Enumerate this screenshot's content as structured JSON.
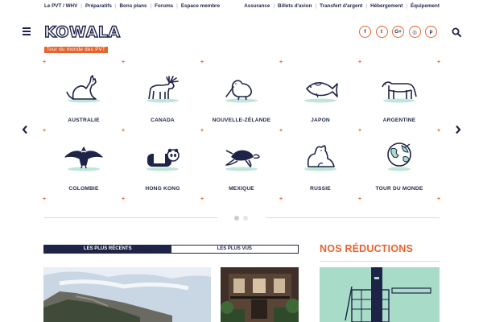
{
  "topbar": {
    "left": [
      "Le PVT / WHV",
      "Préparatifs",
      "Bons plans",
      "Forums",
      "Espace membre"
    ],
    "right": [
      "Assurance",
      "Billets d'avion",
      "Transfert d'argent",
      "Hébergement",
      "Équipement"
    ]
  },
  "header": {
    "logo_word": "KOWALA",
    "logo_tagline": "Tour du monde des PVT",
    "socials": [
      {
        "icon": "facebook-icon",
        "glyph": "f"
      },
      {
        "icon": "twitter-icon",
        "glyph": "t"
      },
      {
        "icon": "google-plus-icon",
        "glyph": "G+"
      },
      {
        "icon": "instagram-icon",
        "glyph": "◎"
      },
      {
        "icon": "pinterest-icon",
        "glyph": "p"
      }
    ],
    "search_icon": "search-icon",
    "menu_icon": "hamburger-menu-icon"
  },
  "destinations": [
    {
      "label": "AUSTRALIE",
      "icon": "kangaroo-icon"
    },
    {
      "label": "CANADA",
      "icon": "moose-icon"
    },
    {
      "label": "NOUVELLE-ZÉLANDE",
      "icon": "kiwi-bird-icon"
    },
    {
      "label": "JAPON",
      "icon": "koi-fish-icon"
    },
    {
      "label": "ARGENTINE",
      "icon": "puma-icon"
    },
    {
      "label": "COLOMBIE",
      "icon": "condor-icon"
    },
    {
      "label": "HONG KONG",
      "icon": "panda-icon"
    },
    {
      "label": "MEXIQUE",
      "icon": "sea-turtle-icon"
    },
    {
      "label": "RUSSIE",
      "icon": "bear-icon"
    },
    {
      "label": "TOUR DU MONDE",
      "icon": "globe-icon"
    }
  ],
  "carousel": {
    "prev_icon": "chevron-left-icon",
    "next_icon": "chevron-right-icon",
    "pages": 2,
    "active_page": 1
  },
  "tabs": [
    "LES PLUS RÉCENTS",
    "LES PLUS VUS"
  ],
  "reductions_title": "NOS RÉDUCTIONS",
  "colors": {
    "navy": "#1e2447",
    "orange": "#e8622c",
    "mint": "#bfe6d8",
    "teal": "#a8dcc8"
  }
}
